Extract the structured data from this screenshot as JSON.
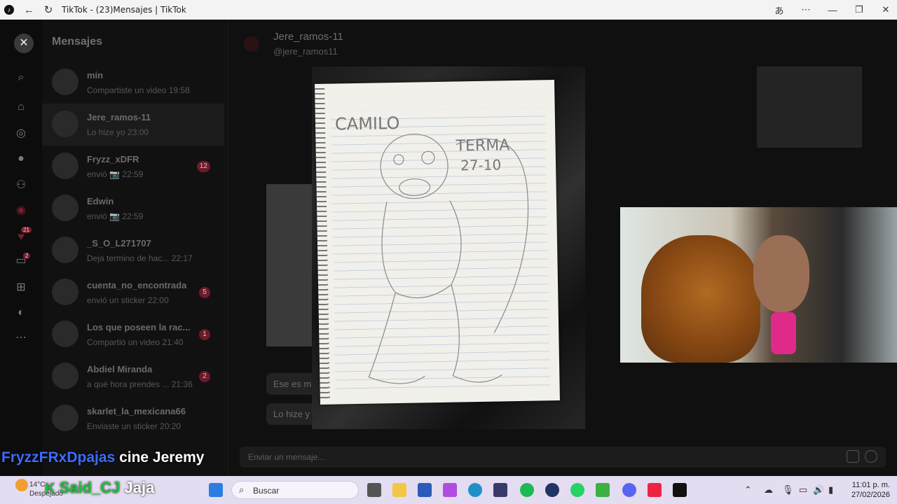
{
  "window": {
    "title": "TikTok - (23)Mensajes | TikTok",
    "tiktok_icon": "tiktok-logo-icon",
    "back_icon": "back-arrow-icon",
    "reload_icon": "reload-icon"
  },
  "sidebar_rail": {
    "close_icon": "close-icon",
    "items": [
      "search-icon",
      "home-icon",
      "explore-icon",
      "live-icon",
      "following-icon",
      "live-profile-icon",
      "activity-icon",
      "messages-icon",
      "upload-icon",
      "profile-icon",
      "more-icon"
    ],
    "activity_badge": "21",
    "messages_badge": "2"
  },
  "messages": {
    "heading": "Mensajes",
    "conversations": [
      {
        "name": "min",
        "preview": "Compartiste un video 19:58",
        "count": ""
      },
      {
        "name": "Jere_ramos-11",
        "preview": "Lo hize yo 23:00",
        "count": ""
      },
      {
        "name": "Fryzz_xDFR",
        "preview": "envió 📷 22:59",
        "count": "12"
      },
      {
        "name": "Edwin",
        "preview": "envió 📷 22:59",
        "count": ""
      },
      {
        "name": "_S_O_L271707",
        "preview": "Deja termino de hac... 22:17",
        "count": ""
      },
      {
        "name": "cuenta_no_encontrada",
        "preview": "envió un sticker 22:00",
        "count": "5"
      },
      {
        "name": "Los que poseen la rac...",
        "preview": "Compartió un video 21:40",
        "count": "1"
      },
      {
        "name": "Abdiel Miranda",
        "preview": "a qué hora prendes ... 21:36",
        "count": "2"
      },
      {
        "name": "skarlet_la_mexicana66",
        "preview": "Enviaste un sticker 20:20",
        "count": ""
      }
    ]
  },
  "chat": {
    "name": "Jere_ramos-11",
    "handle": "@jere_ramos11",
    "bubble1": "Ese es m",
    "bubble2": "Lo hize y",
    "input_placeholder": "Enviar un mensaje...",
    "image_icon": "image-icon",
    "emoji_icon": "emoji-icon"
  },
  "drawing": {
    "text_name": "CAMILO",
    "text_date_1": "TERMA",
    "text_date_2": "27-10"
  },
  "overlays": {
    "line1_user": "FryzzFRxDpajas",
    "line1_msg": "cine Jeremy",
    "line2_badge": "K",
    "line2_user": "Said_CJ",
    "line2_msg": "Jaja"
  },
  "taskbar": {
    "weather_temp": "14°C",
    "weather_desc": "Despejado",
    "search_label": "Buscar",
    "time": "11:01 p. m.",
    "date": "27/02/2026",
    "accent_pink": "#e02a8a"
  }
}
